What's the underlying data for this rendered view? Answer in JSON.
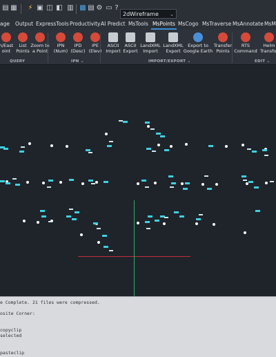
{
  "titlebar": {
    "workspace_value": "2dWireframe"
  },
  "tabs": [
    "age",
    "Output",
    "ExpressTools",
    "Productivity",
    "AI Predict",
    "MsTools",
    "MsPoints",
    "MsCogo",
    "MsTraverse",
    "MsAnnotate",
    "MsM"
  ],
  "active_tab": "MsPoints",
  "ribbon": {
    "buttons": [
      {
        "label": "h/East\noint",
        "icon": "point-red-icon",
        "color": "#d64a3a"
      },
      {
        "label": "List\nPoints",
        "icon": "list-points-icon",
        "color": "#d64a3a"
      },
      {
        "label": "Zoom to\na Point",
        "icon": "zoom-point-icon",
        "color": "#d64a3a"
      },
      {
        "label": "IPN\n(Num)",
        "icon": "ipn-icon",
        "color": "#d64a3a"
      },
      {
        "label": "IPD\n(Desc)",
        "icon": "ipd-icon",
        "color": "#d64a3a"
      },
      {
        "label": "IPE\n(Elev)",
        "icon": "ipe-icon",
        "color": "#d64a3a"
      },
      {
        "label": "ASCII\nImport",
        "icon": "ascii-import-icon",
        "color": "#c7ccd3"
      },
      {
        "label": "ASCII\nExport",
        "icon": "ascii-export-icon",
        "color": "#c7ccd3"
      },
      {
        "label": "LandXML\nImport",
        "icon": "landxml-import-icon",
        "color": "#c7ccd3"
      },
      {
        "label": "LandXML\nExport",
        "icon": "landxml-export-icon",
        "color": "#c7ccd3"
      },
      {
        "label": "Export to\nGoogle Earth",
        "icon": "google-earth-icon",
        "color": "#4a90d9"
      },
      {
        "label": "Transfer\nPoints",
        "icon": "transfer-points-icon",
        "color": "#d64a3a"
      },
      {
        "label": "RTS\nCommand",
        "icon": "rts-command-icon",
        "color": "#d64a3a"
      },
      {
        "label": "Helm\nTransfor",
        "icon": "helmert-transform-icon",
        "color": "#d64a3a"
      }
    ],
    "panels": [
      "QUERY",
      "IPN ⌄",
      "IMPORT/EXPORT ⌄",
      "EDIT ⌄"
    ]
  },
  "command_line": [
    "e Complete. 21 files were compressed.",
    "",
    "osite Corner:",
    "",
    "copyclip",
    "  selected",
    "",
    "",
    "pasteclip"
  ]
}
